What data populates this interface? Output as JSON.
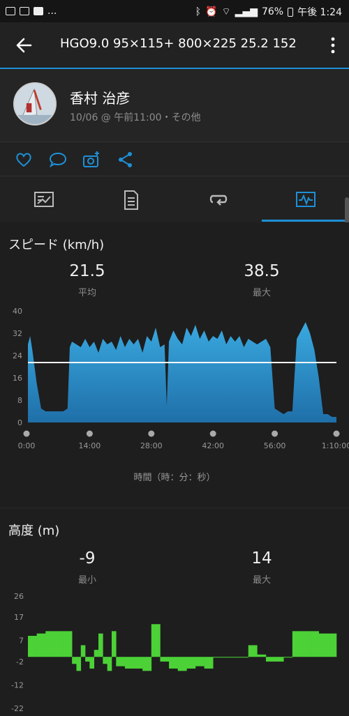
{
  "status": {
    "left_icons": [
      "image-icon",
      "flag-icon",
      "video-icon"
    ],
    "left_more": "...",
    "battery": "76%",
    "time": "午後 1:24"
  },
  "header": {
    "title": "HGO9.0  95×115+   800×225  25.2  152"
  },
  "profile": {
    "name": "香村 治彦",
    "meta": "10/06 @ 午前11:00・その他"
  },
  "actions": [
    "heart-icon",
    "comment-icon",
    "add-photo-icon",
    "share-icon"
  ],
  "tabs": [
    "summary-tab",
    "details-tab",
    "laps-tab",
    "charts-tab"
  ],
  "speed": {
    "title": "スピード (km/h)",
    "avg_value": "21.5",
    "avg_label": "平均",
    "max_value": "38.5",
    "max_label": "最大",
    "time_axis_label": "時間（時：分：秒）"
  },
  "altitude": {
    "title": "高度 (m)",
    "min_value": "-9",
    "min_label": "最小",
    "max_value": "14",
    "max_label": "最大"
  },
  "colors": {
    "accent": "#1e90d6",
    "speed_fill": "#2a95cf",
    "altitude_fill": "#4cd137"
  },
  "chart_data": [
    {
      "type": "area",
      "title": "スピード (km/h)",
      "xlabel": "時間（時：分：秒）",
      "ylabel": "",
      "x_unit": "minutes",
      "yticks": [
        "40",
        "32",
        "24",
        "16",
        "8",
        "0"
      ],
      "ylim": [
        0,
        40
      ],
      "xticks": [
        "0:00",
        "14:00",
        "28:00",
        "42:00",
        "56:00",
        "1:10:00"
      ],
      "xlim": [
        0,
        70
      ],
      "average_line": 21.5,
      "x": [
        0,
        0.5,
        1,
        2,
        3,
        4,
        5,
        6,
        7,
        8,
        9,
        9.5,
        10,
        11,
        12,
        13,
        14,
        15,
        16,
        17,
        18,
        19,
        20,
        21,
        22,
        23,
        24,
        25,
        26,
        27,
        28,
        29,
        30,
        31,
        31.5,
        32,
        33,
        34,
        35,
        36,
        37,
        38,
        39,
        40,
        41,
        42,
        43,
        44,
        45,
        46,
        47,
        48,
        49,
        50,
        51,
        52,
        53,
        54,
        55,
        56,
        57,
        58,
        59,
        60,
        61,
        62,
        63,
        64,
        65,
        66,
        67,
        68,
        69,
        70
      ],
      "y": [
        28,
        31,
        26,
        14,
        5,
        4,
        4,
        4,
        4,
        4,
        5,
        27,
        29,
        28,
        27,
        30,
        27,
        29,
        25,
        30,
        28,
        29,
        26,
        31,
        27,
        30,
        28,
        30,
        25,
        31,
        29,
        34,
        27,
        28,
        6,
        29,
        33,
        30,
        28,
        34,
        31,
        35,
        30,
        33,
        29,
        31,
        30,
        33,
        28,
        31,
        29,
        31,
        27,
        30,
        29,
        28,
        29,
        30,
        27,
        5,
        4,
        3,
        4,
        4,
        30,
        33,
        36,
        32,
        26,
        16,
        3,
        3,
        2,
        2
      ]
    },
    {
      "type": "area",
      "title": "高度 (m)",
      "xlabel": "",
      "ylabel": "",
      "yticks": [
        "26",
        "17",
        "7",
        "-2",
        "-12",
        "-22"
      ],
      "ylim": [
        -22,
        26
      ],
      "x": [
        0,
        2,
        4,
        6,
        8,
        10,
        11,
        12,
        13,
        14,
        15,
        16,
        17,
        18,
        19,
        20,
        22,
        24,
        26,
        28,
        30,
        32,
        34,
        36,
        38,
        40,
        42,
        44,
        46,
        48,
        50,
        52,
        54,
        56,
        58,
        60,
        62,
        64,
        66,
        68,
        70
      ],
      "y": [
        9,
        10,
        11,
        11,
        11,
        -3,
        -6,
        5,
        -2,
        -5,
        3,
        10,
        -3,
        -6,
        11,
        -4,
        -5,
        -5,
        -6,
        14,
        -2,
        -5,
        -6,
        -5,
        -4,
        -5,
        0,
        0,
        0,
        0,
        5,
        1,
        -2,
        -2,
        0,
        11,
        11,
        11,
        10,
        10,
        10
      ]
    }
  ]
}
